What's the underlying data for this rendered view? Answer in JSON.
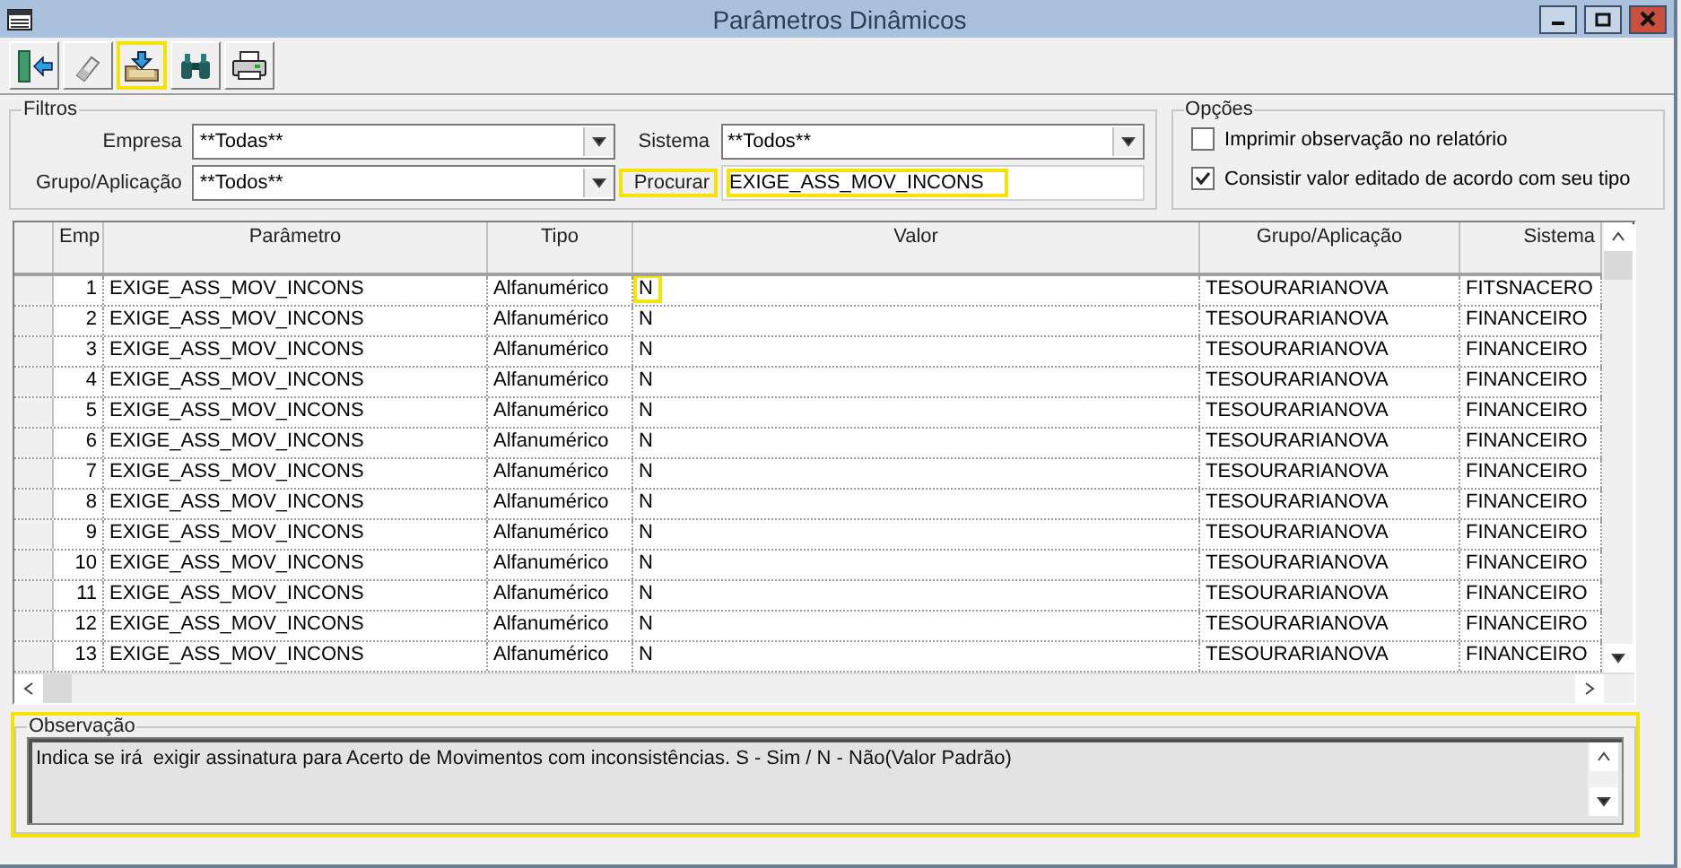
{
  "window": {
    "title": "Parâmetros Dinâmicos"
  },
  "toolbar": [
    {
      "kind": "exit",
      "highlighted": false
    },
    {
      "kind": "eraser",
      "highlighted": false
    },
    {
      "kind": "import",
      "highlighted": true
    },
    {
      "kind": "find",
      "highlighted": false
    },
    {
      "kind": "print",
      "highlighted": false
    }
  ],
  "filters": {
    "title": "Filtros",
    "fields": [
      {
        "label": "Empresa",
        "value": "**Todas**",
        "kind": "dropdown",
        "highlighted": false
      },
      {
        "label": "Sistema",
        "value": "**Todos**",
        "kind": "dropdown",
        "highlighted": false
      },
      {
        "label": "Grupo/Aplicação",
        "value": "**Todos**",
        "kind": "dropdown",
        "highlighted": false
      },
      {
        "label": "Procurar",
        "value": "EXIGE_ASS_MOV_INCONS",
        "kind": "text",
        "highlighted": true
      }
    ]
  },
  "options": {
    "title": "Opções",
    "items": [
      {
        "label": "Imprimir observação no relatório",
        "checked": false
      },
      {
        "label": "Consistir valor editado de acordo com seu tipo",
        "checked": true
      }
    ]
  },
  "table": {
    "columns": [
      "Emp",
      "Parâmetro",
      "Tipo",
      "Valor",
      "Grupo/Aplicação",
      "Sistema"
    ],
    "rows": [
      {
        "cells": [
          "1",
          "EXIGE_ASS_MOV_INCONS",
          "Alfanumérico",
          "N",
          "TESOURARIANOVA",
          "FITSNACERO"
        ],
        "value_highlighted": true
      },
      {
        "cells": [
          "2",
          "EXIGE_ASS_MOV_INCONS",
          "Alfanumérico",
          "N",
          "TESOURARIANOVA",
          "FINANCEIRO"
        ],
        "value_highlighted": false
      },
      {
        "cells": [
          "3",
          "EXIGE_ASS_MOV_INCONS",
          "Alfanumérico",
          "N",
          "TESOURARIANOVA",
          "FINANCEIRO"
        ],
        "value_highlighted": false
      },
      {
        "cells": [
          "4",
          "EXIGE_ASS_MOV_INCONS",
          "Alfanumérico",
          "N",
          "TESOURARIANOVA",
          "FINANCEIRO"
        ],
        "value_highlighted": false
      },
      {
        "cells": [
          "5",
          "EXIGE_ASS_MOV_INCONS",
          "Alfanumérico",
          "N",
          "TESOURARIANOVA",
          "FINANCEIRO"
        ],
        "value_highlighted": false
      },
      {
        "cells": [
          "6",
          "EXIGE_ASS_MOV_INCONS",
          "Alfanumérico",
          "N",
          "TESOURARIANOVA",
          "FINANCEIRO"
        ],
        "value_highlighted": false
      },
      {
        "cells": [
          "7",
          "EXIGE_ASS_MOV_INCONS",
          "Alfanumérico",
          "N",
          "TESOURARIANOVA",
          "FINANCEIRO"
        ],
        "value_highlighted": false
      },
      {
        "cells": [
          "8",
          "EXIGE_ASS_MOV_INCONS",
          "Alfanumérico",
          "N",
          "TESOURARIANOVA",
          "FINANCEIRO"
        ],
        "value_highlighted": false
      },
      {
        "cells": [
          "9",
          "EXIGE_ASS_MOV_INCONS",
          "Alfanumérico",
          "N",
          "TESOURARIANOVA",
          "FINANCEIRO"
        ],
        "value_highlighted": false
      },
      {
        "cells": [
          "10",
          "EXIGE_ASS_MOV_INCONS",
          "Alfanumérico",
          "N",
          "TESOURARIANOVA",
          "FINANCEIRO"
        ],
        "value_highlighted": false
      },
      {
        "cells": [
          "11",
          "EXIGE_ASS_MOV_INCONS",
          "Alfanumérico",
          "N",
          "TESOURARIANOVA",
          "FINANCEIRO"
        ],
        "value_highlighted": false
      },
      {
        "cells": [
          "12",
          "EXIGE_ASS_MOV_INCONS",
          "Alfanumérico",
          "N",
          "TESOURARIANOVA",
          "FINANCEIRO"
        ],
        "value_highlighted": false
      },
      {
        "cells": [
          "13",
          "EXIGE_ASS_MOV_INCONS",
          "Alfanumérico",
          "N",
          "TESOURARIANOVA",
          "FINANCEIRO"
        ],
        "value_highlighted": false
      }
    ]
  },
  "observation": {
    "title": "Observação",
    "text": "Indica se irá  exigir assinatura para Acerto de Movimentos com inconsistências. S - Sim / N - Não(Valor Padrão)",
    "highlighted": true
  }
}
